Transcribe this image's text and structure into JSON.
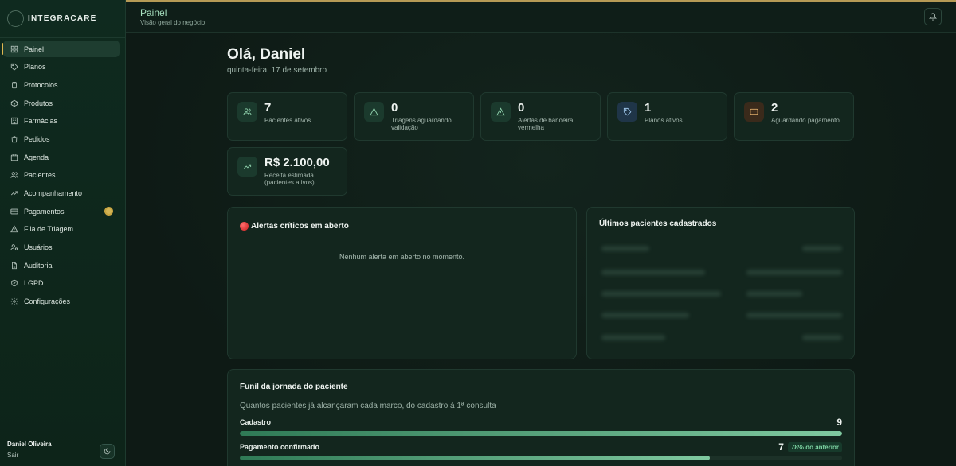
{
  "brand": {
    "name": "INTEGRACARE"
  },
  "sidebar": {
    "items": [
      {
        "label": "Painel",
        "icon": "grid-icon",
        "active": true
      },
      {
        "label": "Planos",
        "icon": "tag-icon"
      },
      {
        "label": "Protocolos",
        "icon": "clipboard-icon"
      },
      {
        "label": "Produtos",
        "icon": "box-icon"
      },
      {
        "label": "Farmácias",
        "icon": "building-icon"
      },
      {
        "label": "Pedidos",
        "icon": "bag-icon"
      },
      {
        "label": "Agenda",
        "icon": "calendar-icon"
      },
      {
        "label": "Pacientes",
        "icon": "users-icon"
      },
      {
        "label": "Acompanhamento",
        "icon": "trend-icon"
      },
      {
        "label": "Pagamentos",
        "icon": "card-icon",
        "badge": true
      },
      {
        "label": "Fila de Triagem",
        "icon": "warning-icon"
      },
      {
        "label": "Usuários",
        "icon": "user-cog-icon"
      },
      {
        "label": "Auditoria",
        "icon": "file-icon"
      },
      {
        "label": "LGPD",
        "icon": "shield-icon"
      },
      {
        "label": "Configurações",
        "icon": "gear-icon"
      }
    ]
  },
  "user": {
    "name": "Daniel Oliveira",
    "logout": "Sair"
  },
  "header": {
    "title": "Painel",
    "subtitle": "Visão geral do negócio"
  },
  "main": {
    "greeting": "Olá, Daniel",
    "date": "quinta-feira, 17 de setembro",
    "stats": [
      {
        "value": "7",
        "label": "Pacientes ativos",
        "icon": "users-icon",
        "tone": "green"
      },
      {
        "value": "0",
        "label": "Triagens aguardando validação",
        "icon": "warning-icon",
        "tone": "green"
      },
      {
        "value": "0",
        "label": "Alertas de bandeira vermelha",
        "icon": "warning-icon",
        "tone": "green"
      },
      {
        "value": "1",
        "label": "Planos ativos",
        "icon": "tag-icon",
        "tone": "blue"
      },
      {
        "value": "2",
        "label": "Aguardando pagamento",
        "icon": "card-icon",
        "tone": "orange"
      },
      {
        "value": "R$ 2.100,00",
        "label": "Receita estimada (pacientes ativos)",
        "icon": "trend-icon",
        "tone": "green"
      }
    ],
    "alerts": {
      "title": "Alertas críticos em aberto",
      "empty": "Nenhum alerta em aberto no momento."
    },
    "recent": {
      "title": "Últimos pacientes cadastrados"
    },
    "funnel": {
      "title": "Funil da jornada do paciente",
      "subtitle": "Quantos pacientes já alcançaram cada marco, do cadastro à 1ª consulta",
      "stages": [
        {
          "label": "Cadastro",
          "count": "9",
          "pct": "",
          "fill": 1.0
        },
        {
          "label": "Pagamento confirmado",
          "count": "7",
          "pct": "78% do anterior",
          "fill": 0.78
        }
      ]
    }
  },
  "colors": {
    "accent": "#e0b850",
    "green": "#7fc9a0",
    "background": "#0e1a15"
  }
}
